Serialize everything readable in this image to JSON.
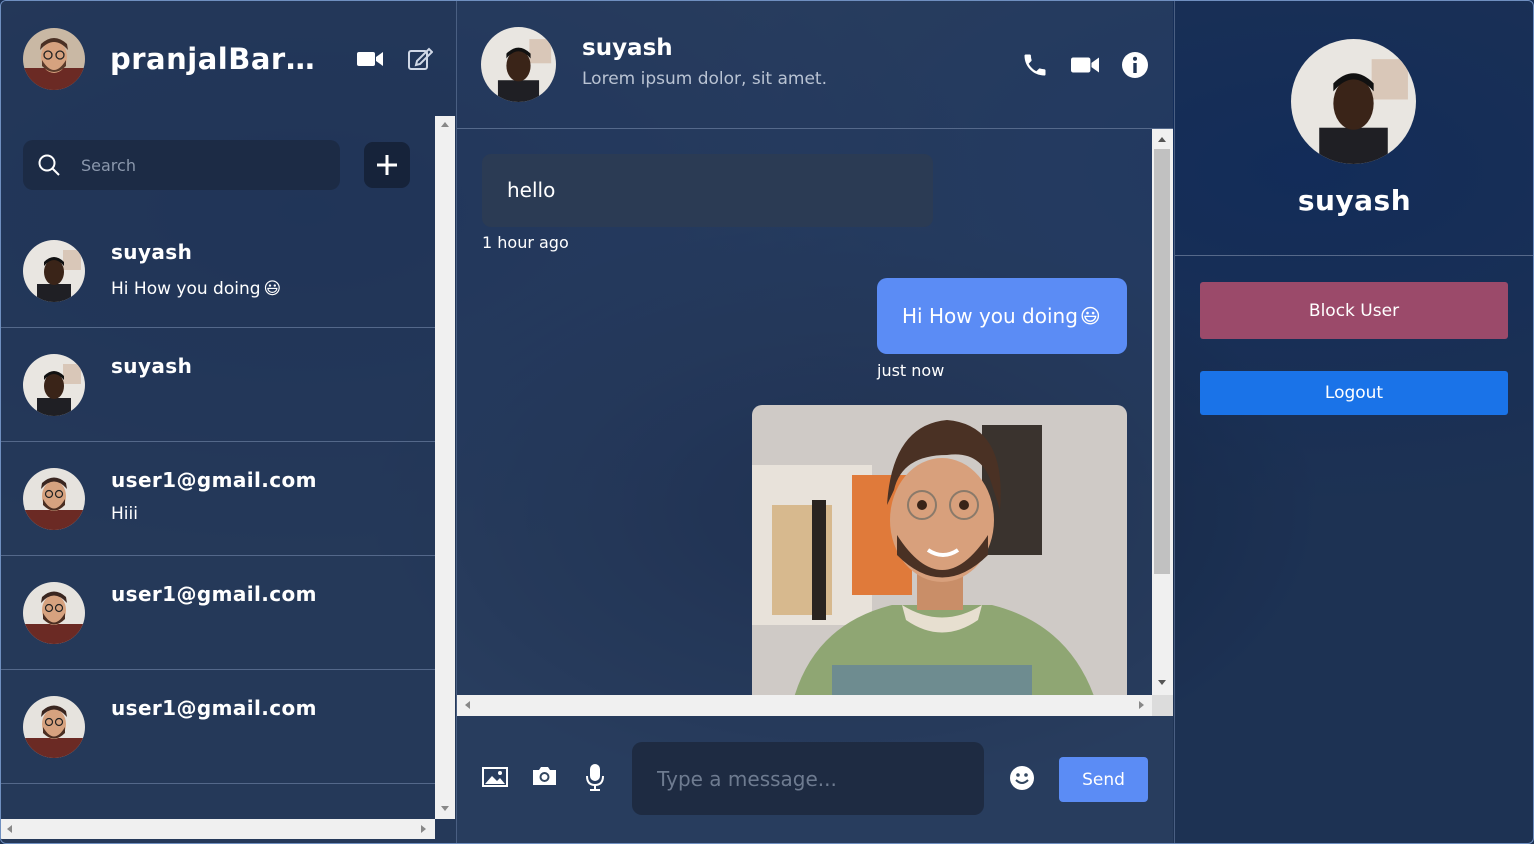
{
  "sidebar": {
    "current_user": "pranjalBarnwal",
    "search_placeholder": "Search",
    "conversations": [
      {
        "name": "suyash",
        "last_message": "Hi How you doing",
        "emoji": "😃",
        "avatar": "male-dark"
      },
      {
        "name": "suyash",
        "last_message": "",
        "emoji": "",
        "avatar": "male-dark"
      },
      {
        "name": "user1@gmail.com",
        "last_message": "Hiii",
        "emoji": "",
        "avatar": "male-beard"
      },
      {
        "name": "user1@gmail.com",
        "last_message": "",
        "emoji": "",
        "avatar": "male-beard"
      },
      {
        "name": "user1@gmail.com",
        "last_message": "",
        "emoji": "",
        "avatar": "male-beard"
      }
    ]
  },
  "chat": {
    "title": "suyash",
    "subtitle": "Lorem ipsum dolor, sit amet.",
    "messages": [
      {
        "direction": "incoming",
        "text": "hello",
        "time": "1 hour ago"
      },
      {
        "direction": "outgoing",
        "text": "Hi How you doing",
        "emoji": "😃",
        "time": "just now"
      },
      {
        "direction": "outgoing",
        "type": "image",
        "image": "cartoon-avatar-photo"
      }
    ],
    "input_placeholder": "Type a message...",
    "send_label": "Send"
  },
  "details": {
    "name": "suyash",
    "block_label": "Block User",
    "logout_label": "Logout"
  },
  "colors": {
    "accent": "#5b8cf5",
    "block": "#9b4a6a",
    "logout": "#1a73e8"
  },
  "icons": [
    "video-icon",
    "edit-icon",
    "search-icon",
    "plus-icon",
    "phone-icon",
    "info-icon",
    "image-icon",
    "camera-icon",
    "mic-icon",
    "emoji-icon"
  ]
}
